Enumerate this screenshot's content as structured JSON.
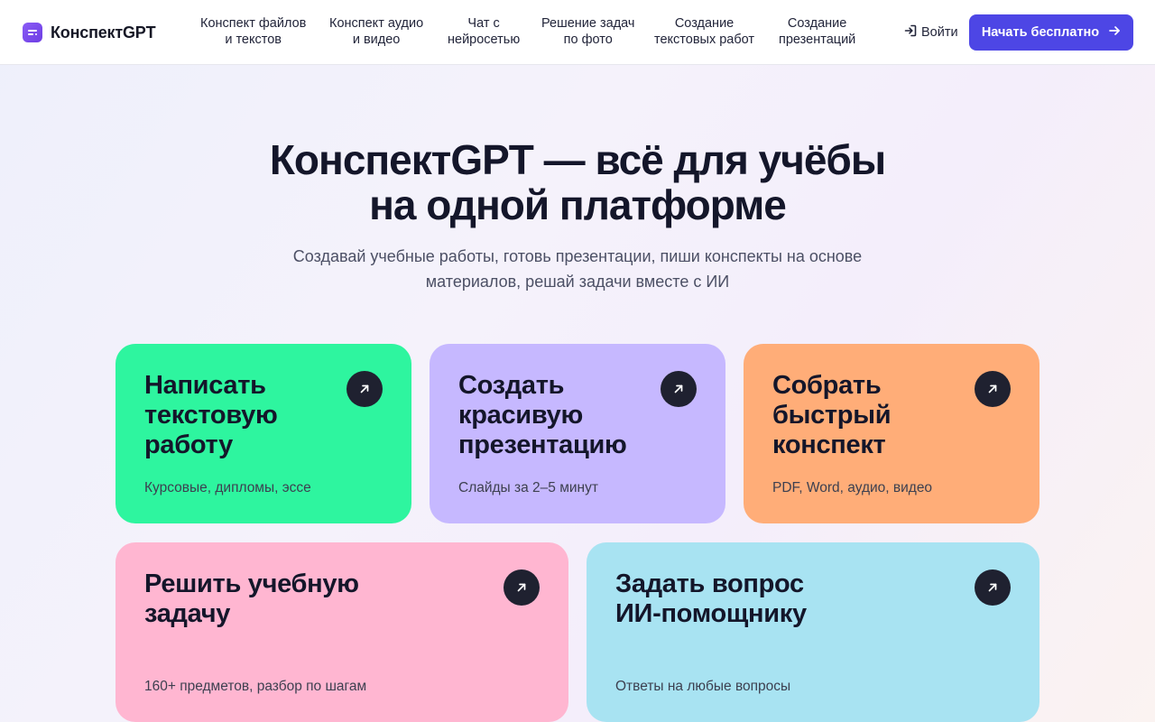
{
  "brand": {
    "name": "КонспектGPT"
  },
  "nav": {
    "items": [
      {
        "line1": "Конспект файлов",
        "line2": "и текстов"
      },
      {
        "line1": "Конспект аудио",
        "line2": "и видео"
      },
      {
        "line1": "Чат с",
        "line2": "нейросетью"
      },
      {
        "line1": "Решение задач",
        "line2": "по фото"
      },
      {
        "line1": "Создание",
        "line2": "текстовых работ"
      },
      {
        "line1": "Создание",
        "line2": "презентаций"
      }
    ],
    "login_label": "Войти",
    "cta_label": "Начать бесплатно"
  },
  "hero": {
    "title_line1": "КонспектGPT — всё для учёбы",
    "title_line2": "на одной платформе",
    "subtitle_line1": "Создавай учебные работы, готовь презентации, пиши конспекты на основе",
    "subtitle_line2": "материалов, решай задачи вместе с ИИ"
  },
  "cards": [
    {
      "line1": "Написать",
      "line2": "текстовую",
      "line3": "работу",
      "subtitle": "Курсовые, дипломы, эссе",
      "color": "#2ef59f"
    },
    {
      "line1": "Создать",
      "line2": "красивую",
      "line3": "презентацию",
      "subtitle": "Слайды за 2–5 минут",
      "color": "#c6b8ff"
    },
    {
      "line1": "Собрать",
      "line2": "быстрый",
      "line3": "конспект",
      "subtitle": "PDF, Word, аудио, видео",
      "color": "#ffad78"
    },
    {
      "line1": "Решить учебную",
      "line2": "задачу",
      "subtitle": "160+ предметов, разбор по шагам",
      "color": "#ffb6d1"
    },
    {
      "line1": "Задать вопрос",
      "line2": "ИИ-помощнику",
      "subtitle": "Ответы на любые вопросы",
      "color": "#a8e3f2"
    }
  ],
  "icons": {
    "logo": "chat-bubble-icon",
    "login": "sign-in-icon",
    "cta": "arrow-right-icon",
    "card": "arrow-up-right-icon"
  }
}
